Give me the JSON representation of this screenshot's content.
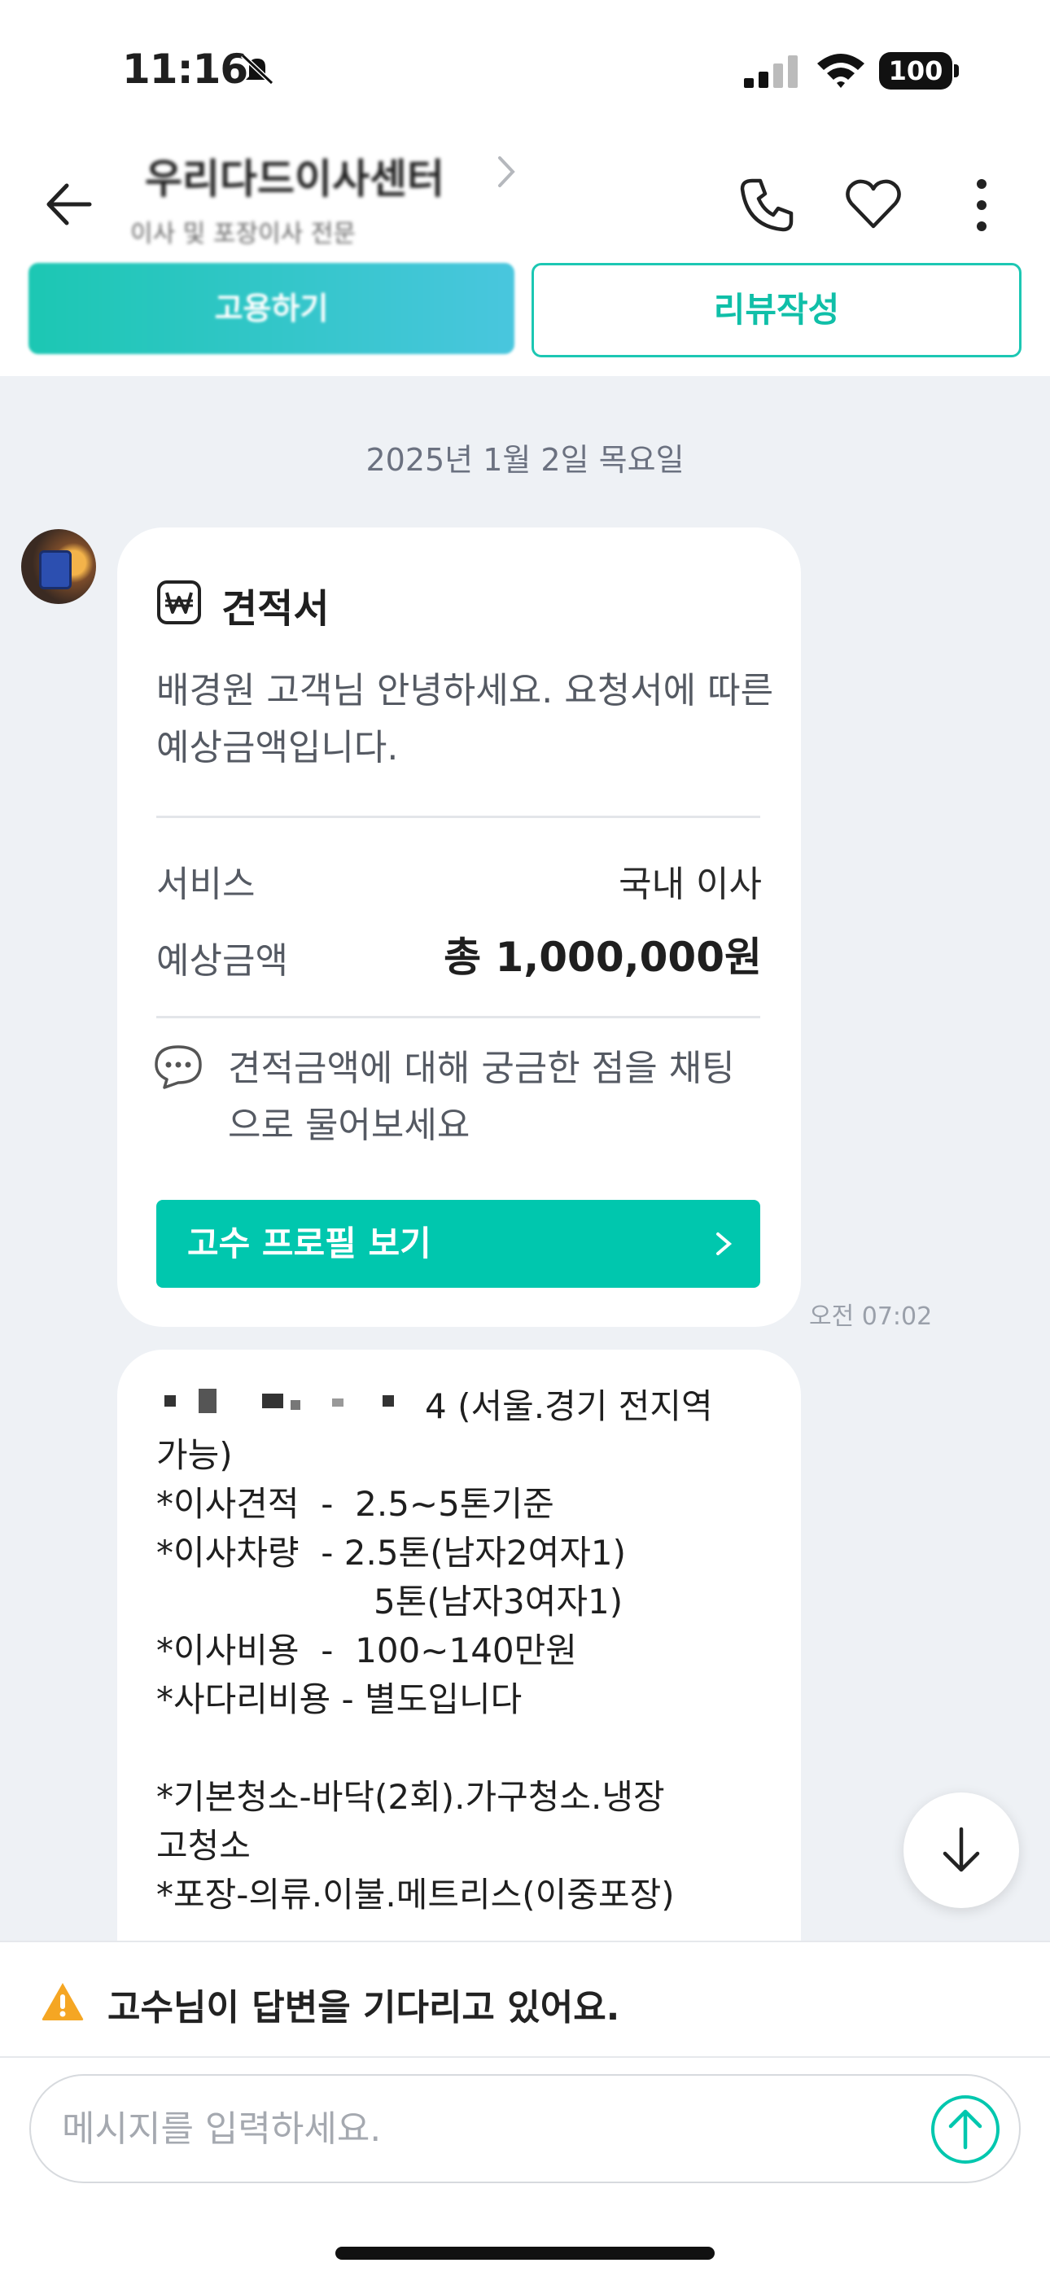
{
  "status_bar": {
    "time": "11:16",
    "battery": "100"
  },
  "header": {
    "shop_name": "우리다드이사센터",
    "shop_subtitle": "이사 및 포장이사 전문",
    "primary_button": "고용하기",
    "review_button": "리뷰작성"
  },
  "chat": {
    "date": "2025년 1월 2일 목요일",
    "quote_card": {
      "title": "견적서",
      "description": "배경원 고객님 안녕하세요. 요청서에 따른 예상금액입니다.",
      "service_label": "서비스",
      "service_value": "국내 이사",
      "price_label": "예상금액",
      "price_value": "총 1,000,000원",
      "question": "견적금액에 대해 궁금한 점을 채팅으로 물어보세요",
      "profile_button": "고수 프로필 보기",
      "time": "오전 07:02"
    },
    "message": {
      "text": "4 (서울.경기 전지역\n가능)\n*이사견적  -  2.5~5톤기준\n*이사차량  - 2.5톤(남자2여자1)\n                    5톤(남자3여자1)\n*이사비용  -  100~140만원\n*사다리비용 - 별도입니다\n\n*기본청소-바닥(2회).가구청소.냉장\n고청소\n*포장-의류.이불.메트리스(이중포장)"
    }
  },
  "notice": {
    "text": "고수님이 답변을 기다리고 있어요."
  },
  "input": {
    "placeholder": "메시지를 입력하세요."
  },
  "colors": {
    "accent": "#00c7ae",
    "warning": "#f5a623",
    "chat_bg": "#eef1f5"
  }
}
